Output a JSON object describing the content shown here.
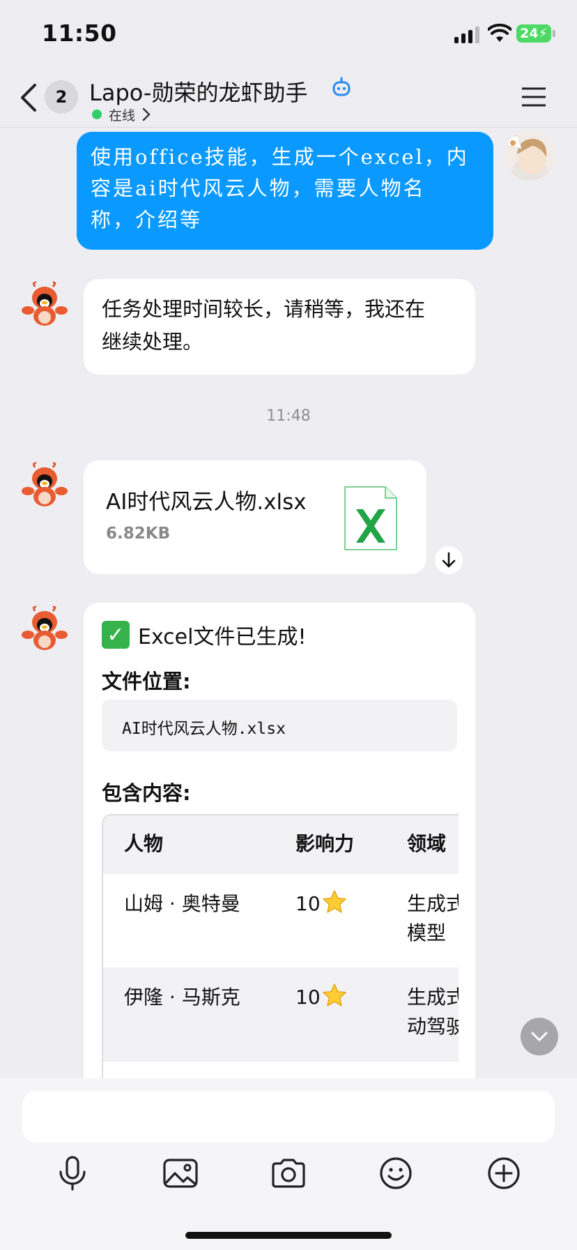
{
  "status_bar": {
    "time": "11:50",
    "battery": "24"
  },
  "header": {
    "unread_count": "2",
    "title": "Lapo-勋荣的龙虾助手",
    "status": "在线"
  },
  "messages": {
    "user_text_lines": [
      "使用office技能，生成一个excel，内",
      "容是ai时代风云人物，需要人物名",
      "称，介绍等"
    ],
    "bot_wait_lines": [
      "任务处理时间较长，请稍等，我还在",
      "继续处理。"
    ],
    "timestamp": "11:48",
    "file": {
      "name": "AI时代风云人物.xlsx",
      "size": "6.82KB",
      "icon": "excel-file-icon"
    },
    "result": {
      "title": "Excel文件已生成!",
      "location_label": "文件位置:",
      "location_value": "AI时代风云人物.xlsx",
      "content_label": "包含内容:",
      "table": {
        "headers": [
          "人物",
          "影响力",
          "领域"
        ],
        "rows": [
          {
            "name": "山姆 · 奥特曼",
            "influence": "10",
            "field_lines": [
              "生成式",
              "模型"
            ]
          },
          {
            "name": "伊隆 · 马斯克",
            "influence": "10",
            "field_lines": [
              "生成式",
              "动驾驶"
            ]
          }
        ]
      }
    }
  },
  "input": {
    "placeholder": ""
  },
  "toolbar": [
    "microphone-icon",
    "image-icon",
    "camera-icon",
    "emoji-icon",
    "plus-icon"
  ],
  "colors": {
    "outgoing_bubble": "#0a99ff",
    "online": "#2fd06a",
    "excel_green": "#21a446",
    "background": "#eeeef2"
  }
}
